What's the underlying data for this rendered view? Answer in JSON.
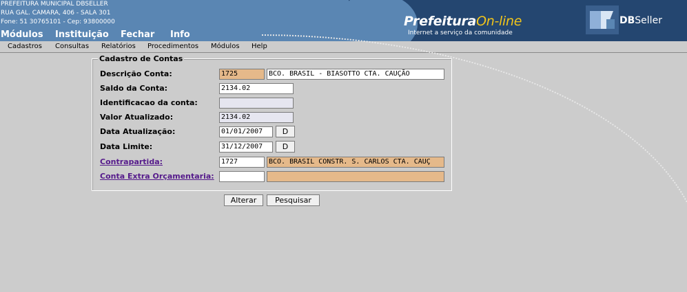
{
  "header": {
    "address_lines": [
      "PREFEITURA MUNICIPAL DBSELLER",
      "RUA GAL. CAMARA, 406 - SALA 301",
      "Fone: 51 30765101  -  Cep: 93800000"
    ],
    "top_menu": [
      "Módulos",
      "Instituição",
      "Fechar",
      "Info"
    ],
    "brand_main": "Prefeitura",
    "brand_highlight": "On-line",
    "tagline": "Internet a serviço da comunidade",
    "company_bold": "DB",
    "company_rest": "Seller",
    "colors": {
      "banner": "#5a86b3",
      "logo_panel": "#244670",
      "highlight": "#f2c51a"
    }
  },
  "menubar": [
    "Cadastros",
    "Consultas",
    "Relatórios",
    "Procedimentos",
    "Módulos",
    "Help"
  ],
  "form": {
    "legend": "Cadastro de Contas",
    "descricao": {
      "label": "Descrição Conta:",
      "code": "1725",
      "name": "BCO. BRASIL -  BIASOTTO CTA. CAUÇÃO"
    },
    "saldo": {
      "label": "Saldo da Conta:",
      "value": "2134.02"
    },
    "identificacao": {
      "label": "Identificacao da conta:",
      "value": ""
    },
    "valor_atualizado": {
      "label": "Valor Atualizado:",
      "value": "2134.02"
    },
    "data_atualizacao": {
      "label": "Data Atualização:",
      "value": "01/01/2007",
      "button": "D"
    },
    "data_limite": {
      "label": "Data Limite:",
      "value": "31/12/2007",
      "button": "D"
    },
    "contrapartida": {
      "label": "Contrapartida:",
      "code": "1727",
      "name": "BCO. BRASIL CONSTR. S. CARLOS CTA. CAUÇ"
    },
    "conta_extra": {
      "label": "Conta Extra Orçamentaria:",
      "code": "",
      "name": ""
    }
  },
  "actions": {
    "alterar": "Alterar",
    "pesquisar": "Pesquisar"
  },
  "colors": {
    "background": "#cccccc",
    "field_tan": "#e5b98a",
    "field_readonly": "#e6e6f0",
    "link": "#551a8b"
  }
}
